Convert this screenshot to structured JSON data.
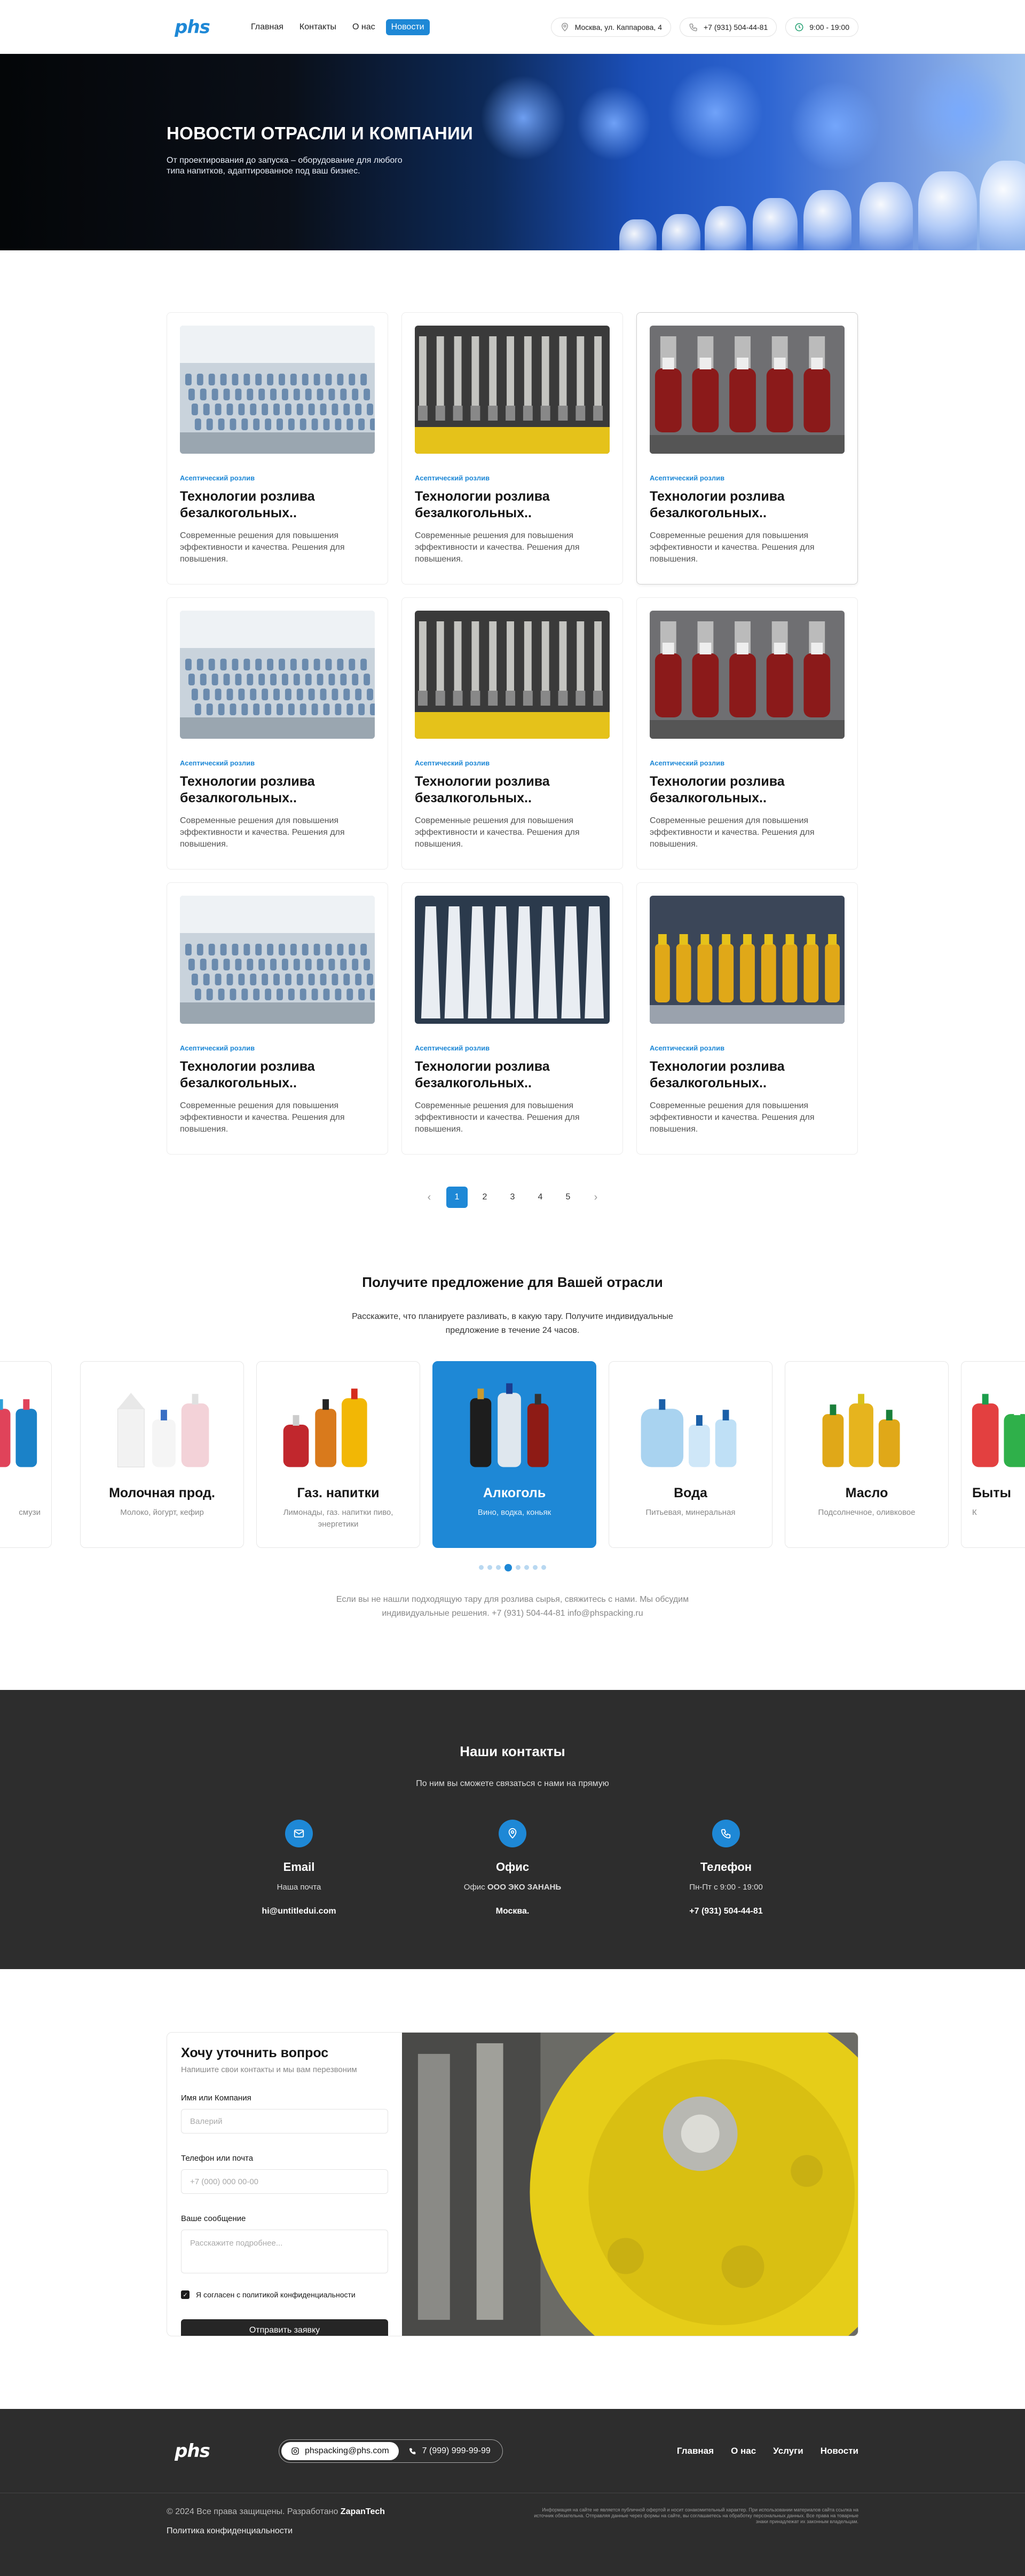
{
  "header": {
    "logo": "phs",
    "nav": [
      "Главная",
      "Контакты",
      "О нас",
      "Новости"
    ],
    "address": "Москва, ул. Каппарова, 4",
    "phone": "+7 (931) 504-44-81",
    "hours": "9:00 - 19:00"
  },
  "hero": {
    "title": "НОВОСТИ ОТРАСЛИ И КОМПАНИИ",
    "text": "От проектирования до запуска – оборудование для любого типа напитков, адаптированное под ваш бизнес."
  },
  "news": {
    "cards": [
      {
        "tag": "Асептический розлив",
        "title": "Технологии розлива безалкогольных..",
        "desc": "Современные решения для повышения эффективности и качества. Решения для повышения.",
        "img": "water-line"
      },
      {
        "tag": "Асептический розлив",
        "title": "Технологии розлива безалкогольных..",
        "desc": "Современные решения для повышения эффективности и качества. Решения для повышения.",
        "img": "yellow-machine"
      },
      {
        "tag": "Асептический розлив",
        "title": "Технологии розлива безалкогольных..",
        "desc": "Современные решения для повышения эффективности и качества. Решения для повышения.",
        "img": "ketchup-line"
      },
      {
        "tag": "Асептический розлив",
        "title": "Технологии розлива безалкогольных..",
        "desc": "Современные решения для повышения эффективности и качества. Решения для повышения.",
        "img": "water-line"
      },
      {
        "tag": "Асептический розлив",
        "title": "Технологии розлива безалкогольных..",
        "desc": "Современные решения для повышения эффективности и качества. Решения для повышения.",
        "img": "yellow-machine"
      },
      {
        "tag": "Асептический розлив",
        "title": "Технологии розлива безалкогольных..",
        "desc": "Современные решения для повышения эффективности и качества. Решения для повышения.",
        "img": "ketchup-line"
      },
      {
        "tag": "Асептический розлив",
        "title": "Технологии розлива безалкогольных..",
        "desc": "Современные решения для повышения эффективности и качества. Решения для повышения.",
        "img": "water-line"
      },
      {
        "tag": "Асептический розлив",
        "title": "Технологии розлива безалкогольных..",
        "desc": "Современные решения для повышения эффективности и качества. Решения для повышения.",
        "img": "white-bottles"
      },
      {
        "tag": "Асептический розлив",
        "title": "Технологии розлива безалкогольных..",
        "desc": "Современные решения для повышения эффективности и качества. Решения для повышения.",
        "img": "oil-line"
      }
    ]
  },
  "pager": {
    "prev": "‹",
    "next": "›",
    "pages": [
      "1",
      "2",
      "3",
      "4",
      "5"
    ],
    "current": "1"
  },
  "offer": {
    "title": "Получите предложение для Вашей отрасли",
    "subtitle": "Расскажите, что планируете разливать, в какую тару. Получите индивидуальные предложение в течение 24 часов.",
    "categories": [
      {
        "name": "",
        "desc": "смузи",
        "art": "smoothie"
      },
      {
        "name": "Молочная прод.",
        "desc": "Молоко, йогурт, кефир",
        "art": "milk"
      },
      {
        "name": "Газ. напитки",
        "desc": "Лимонады, газ. напитки пиво, энергетики",
        "art": "soda"
      },
      {
        "name": "Алкоголь",
        "desc": "Вино, водка, коньяк",
        "art": "alcohol"
      },
      {
        "name": "Вода",
        "desc": "Питьевая, минеральная",
        "art": "water"
      },
      {
        "name": "Масло",
        "desc": "Подсолнечное, оливковое",
        "art": "oil"
      },
      {
        "name": "Быты",
        "desc": "К",
        "art": "household"
      }
    ],
    "active_index": 3,
    "dots_total": 8,
    "dots_active": 3,
    "note": "Если вы не нашли подходящую тару для розлива сырья, свяжитесь с нами. Мы обсудим индивидуальные решения. +7 (931) 504-44-81 info@phspacking.ru"
  },
  "contacts": {
    "title": "Наши контакты",
    "subtitle": "По ним вы сможете связаться с нами на прямую",
    "items": [
      {
        "icon": "mail-icon",
        "heading": "Email",
        "text": "Наша почта",
        "value": "hi@untitledui.com"
      },
      {
        "icon": "location-icon",
        "heading": "Офис",
        "text_prefix": "Офис ",
        "text_bold": "ООО ЭКО ЗАНАНЬ",
        "value": "Москва."
      },
      {
        "icon": "phone-icon",
        "heading": "Телефон",
        "text": "Пн-Пт с 9:00 - 19:00",
        "value": "+7 (931) 504-44-81"
      }
    ]
  },
  "form": {
    "title": "Хочу уточнить вопрос",
    "subtitle": "Напишите свои контакты и мы вам перезвоним",
    "fields": [
      {
        "label": "Имя или Компания",
        "placeholder": "Валерий"
      },
      {
        "label": "Телефон или почта",
        "placeholder": "+7 (000) 000 00-00"
      },
      {
        "label": "Ваше сообщение",
        "placeholder": "Расскажите подробнее..."
      }
    ],
    "consent": "Я согласен с политикой конфиденциальности",
    "submit": "Отправить заявку"
  },
  "footer": {
    "email": "phspacking@phs.com",
    "phone": "7 (999) 999-99-99",
    "nav": [
      "Главная",
      "О нас",
      "Услуги",
      "Новости"
    ],
    "copyright": "© 2024 Все права защищены. Разработано ",
    "developer": "ZapanTech",
    "policy": "Политика конфиденциальности",
    "legal": "Информация на сайте не является публичной офертой и носит ознакомительный характер. При использовании материалов сайта ссылка на источник обязательна. Отправляя данные через формы на сайте, вы соглашаетесь на обработку персональных данных. Все права на товарные знаки принадлежат их законным владельцам."
  }
}
